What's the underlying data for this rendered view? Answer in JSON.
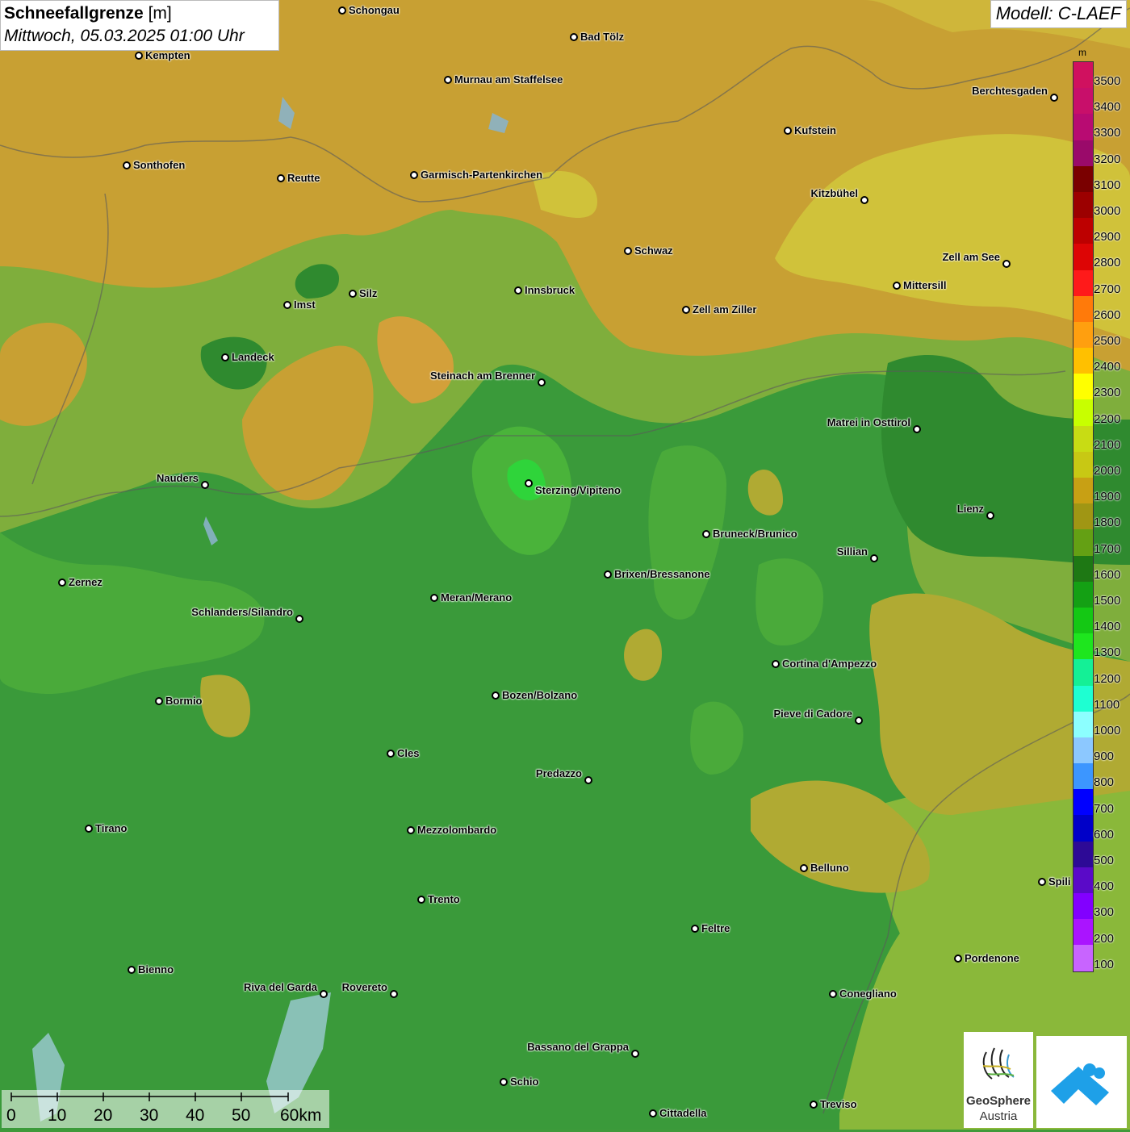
{
  "title": {
    "bold": "Schneefallgrenze",
    "unit": " [m]",
    "subtitle": "Mittwoch, 05.03.2025 01:00 Uhr"
  },
  "model": "Modell: C-LAEF",
  "legend": {
    "unit": "m",
    "levels": [
      {
        "label": "3500",
        "color": "#d0115f"
      },
      {
        "label": "3400",
        "color": "#c80f6a"
      },
      {
        "label": "3300",
        "color": "#b80b72"
      },
      {
        "label": "3200",
        "color": "#9a0a6a"
      },
      {
        "label": "3100",
        "color": "#7a0000"
      },
      {
        "label": "3000",
        "color": "#9c0000"
      },
      {
        "label": "2900",
        "color": "#bd0000"
      },
      {
        "label": "2800",
        "color": "#dd0505"
      },
      {
        "label": "2700",
        "color": "#ff1a1a"
      },
      {
        "label": "2600",
        "color": "#ff7a0a"
      },
      {
        "label": "2500",
        "color": "#ff9f0f"
      },
      {
        "label": "2400",
        "color": "#ffc000"
      },
      {
        "label": "2300",
        "color": "#ffff00"
      },
      {
        "label": "2200",
        "color": "#c8ff00"
      },
      {
        "label": "2100",
        "color": "#c8dc14"
      },
      {
        "label": "2000",
        "color": "#c8c814"
      },
      {
        "label": "1900",
        "color": "#c8a014"
      },
      {
        "label": "1800",
        "color": "#a09614"
      },
      {
        "label": "1700",
        "color": "#64a014"
      },
      {
        "label": "1600",
        "color": "#1e7814"
      },
      {
        "label": "1500",
        "color": "#14a014"
      },
      {
        "label": "1400",
        "color": "#14c814"
      },
      {
        "label": "1300",
        "color": "#1ee61e"
      },
      {
        "label": "1200",
        "color": "#14f096"
      },
      {
        "label": "1100",
        "color": "#1effd2"
      },
      {
        "label": "1000",
        "color": "#8cffff"
      },
      {
        "label": "900",
        "color": "#8cc8ff"
      },
      {
        "label": "800",
        "color": "#3c96ff"
      },
      {
        "label": "700",
        "color": "#0000ff"
      },
      {
        "label": "600",
        "color": "#0000c8"
      },
      {
        "label": "500",
        "color": "#2d0a96"
      },
      {
        "label": "400",
        "color": "#5a0ac8"
      },
      {
        "label": "300",
        "color": "#8200ff"
      },
      {
        "label": "200",
        "color": "#aa14ff"
      },
      {
        "label": "100",
        "color": "#c864ff"
      }
    ]
  },
  "cities": [
    {
      "name": "Schongau"
    },
    {
      "name": "Bad Tölz"
    },
    {
      "name": "Kempten"
    },
    {
      "name": "Murnau am Staffelsee"
    },
    {
      "name": "Berchtesgaden"
    },
    {
      "name": "Kufstein"
    },
    {
      "name": "Sonthofen"
    },
    {
      "name": "Reutte"
    },
    {
      "name": "Garmisch-Partenkirchen"
    },
    {
      "name": "Kitzbühel"
    },
    {
      "name": "Schwaz"
    },
    {
      "name": "Zell am See"
    },
    {
      "name": "Innsbruck"
    },
    {
      "name": "Silz"
    },
    {
      "name": "Imst"
    },
    {
      "name": "Mittersill"
    },
    {
      "name": "Zell am Ziller"
    },
    {
      "name": "Landeck"
    },
    {
      "name": "Steinach am Brenner"
    },
    {
      "name": "Matrei in Osttirol"
    },
    {
      "name": "Nauders"
    },
    {
      "name": "Sterzing/Vipiteno"
    },
    {
      "name": "Lienz"
    },
    {
      "name": "Bruneck/Brunico"
    },
    {
      "name": "Sillian"
    },
    {
      "name": "Zernez"
    },
    {
      "name": "Brixen/Bressanone"
    },
    {
      "name": "Meran/Merano"
    },
    {
      "name": "Schlanders/Silandro"
    },
    {
      "name": "Cortina d'Ampezzo"
    },
    {
      "name": "Bozen/Bolzano"
    },
    {
      "name": "Bormio"
    },
    {
      "name": "Pieve di Cadore"
    },
    {
      "name": "Cles"
    },
    {
      "name": "Predazzo"
    },
    {
      "name": "Tirano"
    },
    {
      "name": "Mezzolombardo"
    },
    {
      "name": "Belluno"
    },
    {
      "name": "Spili"
    },
    {
      "name": "Trento"
    },
    {
      "name": "Feltre"
    },
    {
      "name": "Pordenone"
    },
    {
      "name": "Bienno"
    },
    {
      "name": "Riva del Garda"
    },
    {
      "name": "Rovereto"
    },
    {
      "name": "Conegliano"
    },
    {
      "name": "Bassano del Grappa"
    },
    {
      "name": "Schio"
    },
    {
      "name": "Treviso"
    },
    {
      "name": "Cittadella"
    }
  ],
  "scale": {
    "labels": [
      "0",
      "10",
      "20",
      "30",
      "40",
      "50",
      "60km"
    ]
  },
  "logos": {
    "geosphere_line1": "GeoSphere",
    "geosphere_line2": "Austria"
  },
  "colors": {
    "band_1500": "#3f9a3a",
    "band_1600": "#2f8a2f",
    "band_1700": "#6fa832",
    "band_1800": "#a3a52c",
    "band_1900": "#c6a433",
    "band_2000": "#c8c034"
  }
}
